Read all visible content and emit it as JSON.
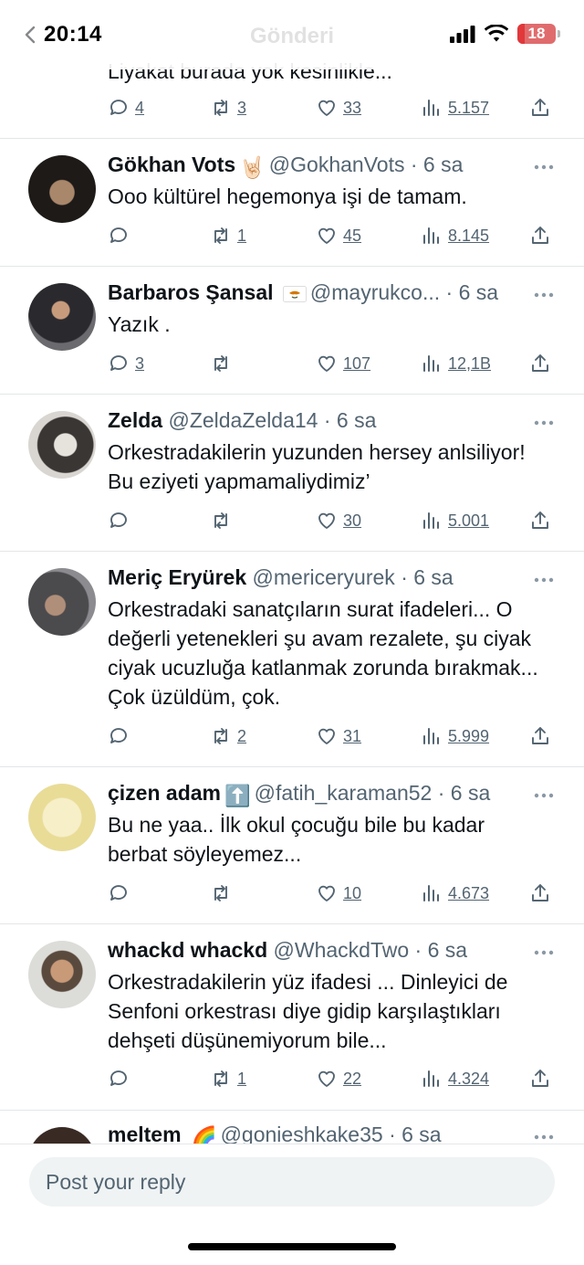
{
  "status": {
    "time": "20:14",
    "battery": "18",
    "battery_level": 0.18
  },
  "header": {
    "title": "Gönderi"
  },
  "colors": {
    "text": "#0f1419",
    "secondary": "#536471",
    "divider": "#e3e6e8",
    "battery": "#e0383b"
  },
  "partial_tweet": {
    "text": "Liyakat burada yok kesinlikle...",
    "replies": "4",
    "retweets": "3",
    "likes": "33",
    "views": "5.157"
  },
  "tweets": [
    {
      "name": "Gökhan Vots",
      "badge": "🤘🏻",
      "handle": "@GokhanVots",
      "dot": "·",
      "time": "6 sa",
      "text": "Ooo kültürel hegemonya işi de tamam.",
      "replies": "",
      "retweets": "1",
      "likes": "45",
      "views": "8.145"
    },
    {
      "name": "Barbaros Şansal",
      "badge": "flag-cy",
      "handle": "@mayrukco...",
      "dot": "·",
      "time": "6 sa",
      "text": "Yazık .",
      "replies": "3",
      "retweets": "",
      "likes": "107",
      "views": "12,1B"
    },
    {
      "name": "Zelda",
      "badge": "",
      "handle": "@ZeldaZelda14",
      "dot": "·",
      "time": "6 sa",
      "text": "Orkestradakilerin yuzunden hersey anlsiliyor! Bu eziyeti yapmamaliydimiz’",
      "replies": "",
      "retweets": "",
      "likes": "30",
      "views": "5.001"
    },
    {
      "name": "Meriç Eryürek",
      "badge": "",
      "handle": "@mericeryurek",
      "dot": "·",
      "time": "6 sa",
      "text": "Orkestradaki sanatçıların surat ifadeleri... O değerli yetenekleri şu avam rezalete, şu ciyak ciyak ucuzluğa katlanmak zorunda bırakmak... Çok üzüldüm, çok.",
      "replies": "",
      "retweets": "2",
      "likes": "31",
      "views": "5.999"
    },
    {
      "name": "çizen adam",
      "badge": "⬆️",
      "handle": "@fatih_karaman52",
      "dot": "·",
      "time": "6 sa",
      "text": "Bu ne yaa.. İlk okul çocuğu bile bu kadar berbat söyleyemez...",
      "replies": "",
      "retweets": "",
      "likes": "10",
      "views": "4.673"
    },
    {
      "name": "whackd whackd",
      "badge": "",
      "handle": "@WhackdTwo",
      "dot": "·",
      "time": "6 sa",
      "text": "Orkestradakilerin yüz ifadesi ... Dinleyici de Senfoni orkestrası diye gidip karşılaştıkları dehşeti düşünemiyorum bile...",
      "replies": "",
      "retweets": "1",
      "likes": "22",
      "views": "4.324"
    },
    {
      "name": "meltem",
      "badge": "🌈",
      "handle": "@gonieshkake35",
      "dot": "·",
      "time": "6 sa",
      "text": "",
      "replies": "",
      "retweets": "",
      "likes": "",
      "views": ""
    }
  ],
  "reply_bar": {
    "placeholder": "Post your reply"
  }
}
